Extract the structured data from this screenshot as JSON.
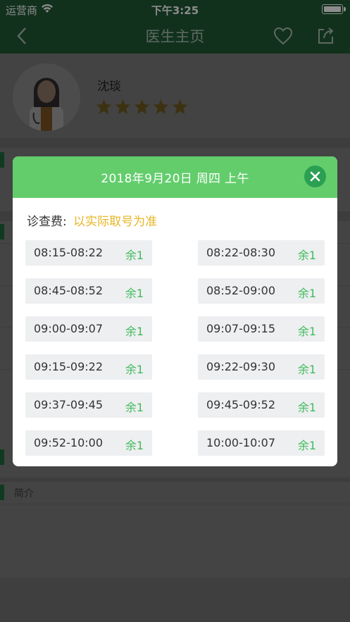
{
  "status_bar": {
    "carrier": "运营商",
    "time": "下午3:25"
  },
  "nav": {
    "title": "医生主页",
    "back_icon": "chevron-left-icon",
    "favorite_icon": "heart-icon",
    "share_icon": "share-icon"
  },
  "doctor": {
    "name": "沈琰",
    "rating": 5
  },
  "sections": {
    "intro_label": "简介"
  },
  "modal": {
    "title": "2018年9月20日  周四  上午",
    "fee_label": "诊查费:",
    "fee_value": "以实际取号为准",
    "close_icon": "close-icon",
    "slots": [
      {
        "range": "08:15-08:22",
        "remain": "余1"
      },
      {
        "range": "08:22-08:30",
        "remain": "余1"
      },
      {
        "range": "08:45-08:52",
        "remain": "余1"
      },
      {
        "range": "08:52-09:00",
        "remain": "余1"
      },
      {
        "range": "09:00-09:07",
        "remain": "余1"
      },
      {
        "range": "09:07-09:15",
        "remain": "余1"
      },
      {
        "range": "09:15-09:22",
        "remain": "余1"
      },
      {
        "range": "09:22-09:30",
        "remain": "余1"
      },
      {
        "range": "09:37-09:45",
        "remain": "余1"
      },
      {
        "range": "09:45-09:52",
        "remain": "余1"
      },
      {
        "range": "09:52-10:00",
        "remain": "余1"
      },
      {
        "range": "10:00-10:07",
        "remain": "余1"
      }
    ]
  },
  "colors": {
    "header_green": "#63cd6c",
    "close_green": "#2b9f52",
    "remain_green": "#3fbb5c",
    "fee_yellow": "#e6b626",
    "star_gold": "#e6b626"
  }
}
